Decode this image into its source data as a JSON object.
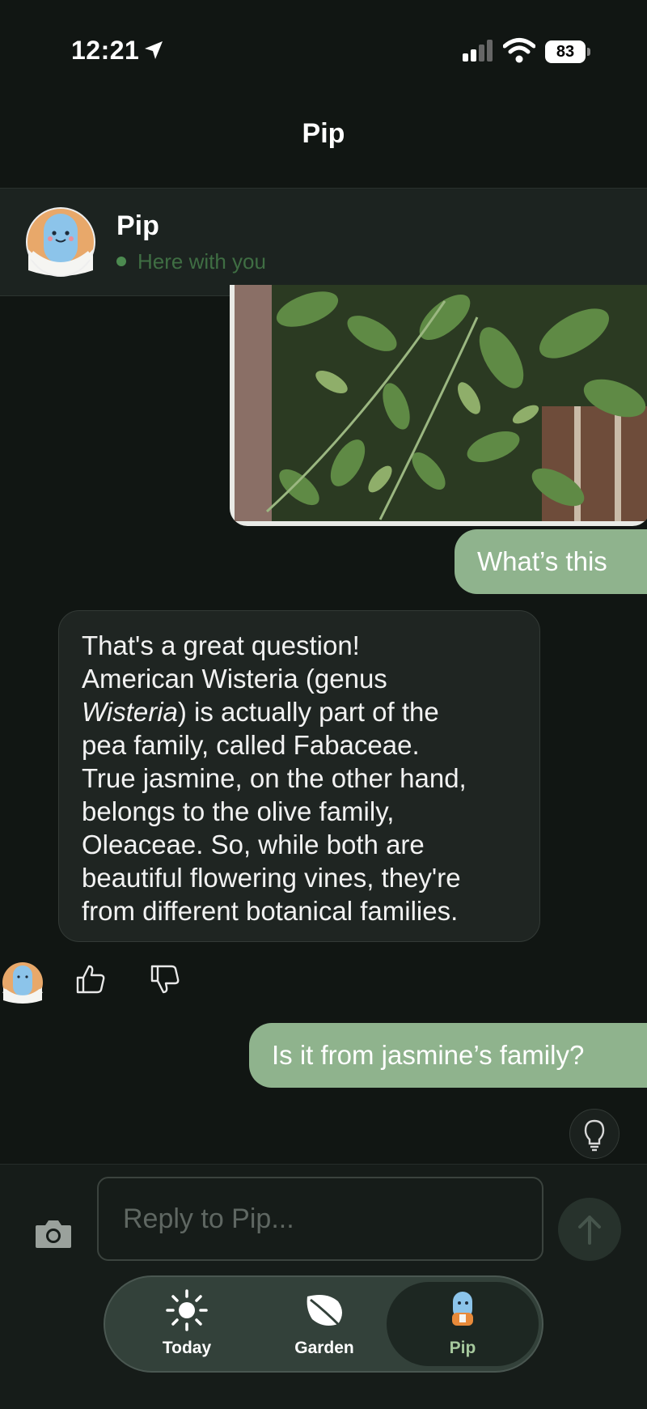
{
  "status_bar": {
    "time": "12:21",
    "battery": "83"
  },
  "nav": {
    "title": "Pip"
  },
  "header": {
    "name": "Pip",
    "status": "Here with you"
  },
  "messages": {
    "user_1": "What’s this",
    "bot_1": {
      "line_1": "That's a great question!",
      "line_2": "American Wisteria (genus",
      "line_3_italic": "Wisteria",
      "line_3_rest": ") is actually part of the",
      "line_4": "pea family, called Fabaceae.",
      "line_5": "True jasmine, on the other hand,",
      "line_6": "belongs to the olive family,",
      "line_7": "Oleaceae. So, while both are",
      "line_8": "beautiful flowering vines, they're",
      "line_9": "from different botanical families."
    },
    "user_2": "Is it from jasmine’s family?"
  },
  "composer": {
    "placeholder": "Reply to Pip..."
  },
  "tabs": [
    {
      "label": "Today",
      "icon": "sun-icon"
    },
    {
      "label": "Garden",
      "icon": "leaf-icon"
    },
    {
      "label": "Pip",
      "icon": "pip-mascot-icon",
      "active": true
    }
  ],
  "colors": {
    "background": "#111613",
    "user_bubble": "#8fb38d",
    "online": "#4c8a50"
  }
}
